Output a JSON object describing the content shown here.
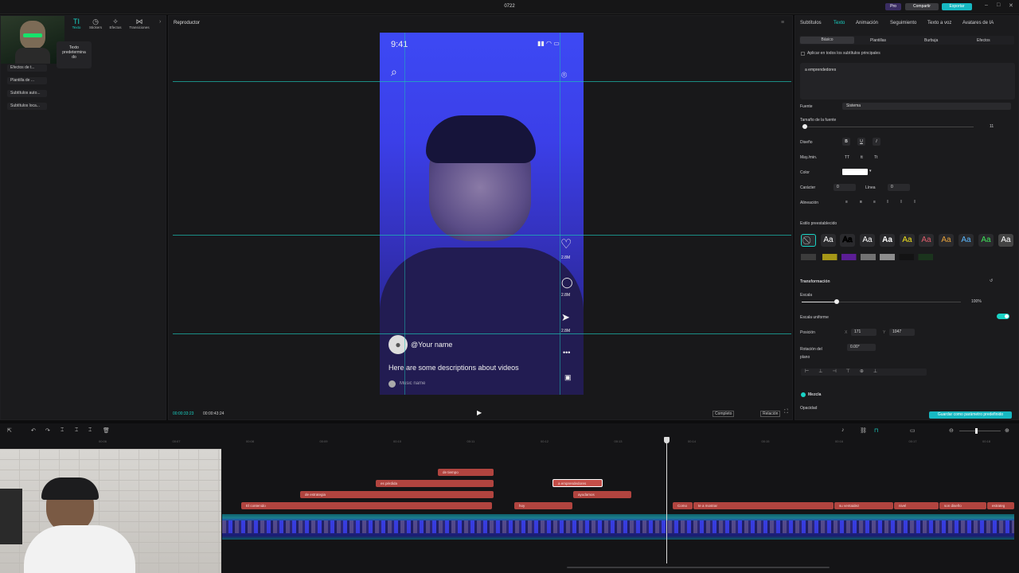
{
  "window": {
    "title": "0722"
  },
  "header": {
    "pro_label": "Pro",
    "share_label": "Compartir",
    "export_label": "Exportar"
  },
  "toolbar": {
    "tools": [
      {
        "label": "Texto",
        "icon": "text-icon"
      },
      {
        "label": "Stickers",
        "icon": "sticker-icon"
      },
      {
        "label": "Efectos",
        "icon": "effects-icon"
      },
      {
        "label": "Transiciones",
        "icon": "transitions-icon"
      }
    ],
    "preset_tile": "Texto predetermina do"
  },
  "sidebar": {
    "items": [
      {
        "label": "Efectos de t..."
      },
      {
        "label": "Plantilla de ..."
      },
      {
        "label": "Subtítulos auto..."
      },
      {
        "label": "Subtítulos loca..."
      }
    ]
  },
  "player": {
    "title": "Reproductor",
    "current_time": "00:00:33:23",
    "total_time": "00:00:43:24",
    "ratio_label": "Completo",
    "ratio2_label": "Relación"
  },
  "phone": {
    "time": "9:41",
    "like_count": "2.8M",
    "comment_count": "2.8M",
    "share_count": "2.8M",
    "username": "@Your name",
    "description": "Here are some descriptions about videos",
    "music": "Music name"
  },
  "right_panel": {
    "tabs": [
      "Subtítulos",
      "Texto",
      "Animación",
      "Seguimiento",
      "Texto a voz",
      "Avatares de IA"
    ],
    "active_tab": "Texto",
    "subtabs": [
      "Básico",
      "Plantillas",
      "Burbuja",
      "Efectos"
    ],
    "apply_all": "Aplicar en todos los subtítulos principales",
    "text_value": "a emprendedores",
    "font_label": "Fuente",
    "font_value": "Sistema",
    "size_label": "Tamaño de la fuente",
    "size_value": "11",
    "design_label": "Diseño",
    "case_label": "May./min.",
    "color_label": "Color",
    "char_label": "Carácter",
    "char_value": "0",
    "line_label": "Línea",
    "line_value": "0",
    "align_label": "Alineación",
    "preset_style_label": "Estilo preestablecido",
    "transform_label": "Transformación",
    "scale_label": "Escala",
    "scale_value": "100%",
    "scale_level": 0.22,
    "uniform_label": "Escala uniforme",
    "position_label": "Posición",
    "pos_x_label": "X",
    "pos_x": "171",
    "pos_y_label": "Y",
    "pos_y": "1047",
    "rotation_label": "Rotación del plano",
    "rotation_value": "0.00°",
    "blend_label": "Mezcla",
    "opacity_label": "Opacidad",
    "save_default": "Guardar como parámetro predefinido"
  },
  "timeline": {
    "ticks": [
      "00:06",
      "00:07",
      "00:08",
      "00:09",
      "00:10",
      "00:11",
      "00:12",
      "00:13",
      "00:14",
      "00:15",
      "00:16",
      "00:17",
      "00:18"
    ],
    "clips_row1": [
      {
        "label": "de tiempo"
      }
    ],
    "clips_row2": [
      {
        "label": "es pérdida"
      },
      {
        "label": "a emprendedores"
      }
    ],
    "clips_row3": [
      {
        "label": "de estrategia"
      },
      {
        "label": "ayudamos"
      }
    ],
    "clips_row4": [
      {
        "label": "El contenido"
      },
      {
        "label": "hoy"
      },
      {
        "label": "Como"
      },
      {
        "label": "te a mostrar"
      },
      {
        "label": "su ventaidez"
      },
      {
        "label": "nivel"
      },
      {
        "label": "son diseño"
      },
      {
        "label": "estrateg"
      }
    ]
  },
  "colors": {
    "accent": "#19d3c5",
    "clip": "#b1443f",
    "export": "#17b8c2"
  }
}
